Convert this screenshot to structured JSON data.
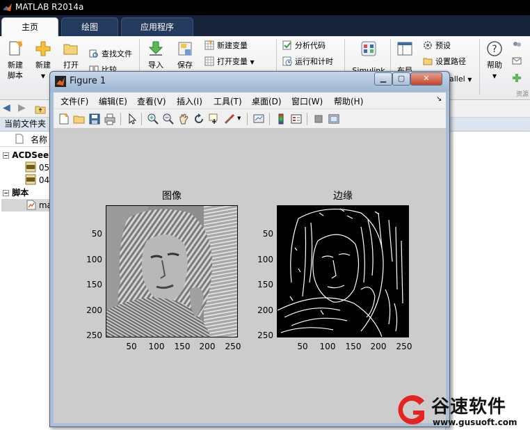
{
  "app": {
    "title": "MATLAB R2014a"
  },
  "ribbon_tabs": [
    {
      "label": "主页",
      "active": true
    },
    {
      "label": "绘图",
      "active": false
    },
    {
      "label": "应用程序",
      "active": false
    }
  ],
  "ribbon": {
    "new_script": [
      "新建",
      "脚本"
    ],
    "new": "新建",
    "open": "打开",
    "find_files": "查找文件",
    "compare": "比较",
    "import": "导入",
    "save": "保存",
    "new_variable": "新建变量",
    "open_variable": "打开变量",
    "analyze_code": "分析代码",
    "run_and_time": "运行和计时",
    "simulink": "Simulink",
    "layout": "布局",
    "preferences": "预设",
    "set_path": "设置路径",
    "parallel": "allel",
    "help": "帮助",
    "resources": "资源"
  },
  "current_folder": {
    "header": "当前文件夹",
    "name_col": "名称"
  },
  "tree": [
    {
      "label": "ACDSee",
      "kind": "group"
    },
    {
      "label": "05",
      "kind": "file"
    },
    {
      "label": "04",
      "kind": "file"
    },
    {
      "label": "脚本",
      "kind": "group"
    },
    {
      "label": "ma",
      "kind": "file-selected"
    }
  ],
  "figure": {
    "title": "Figure 1",
    "menu": [
      "文件(F)",
      "编辑(E)",
      "查看(V)",
      "插入(I)",
      "工具(T)",
      "桌面(D)",
      "窗口(W)",
      "帮助(H)"
    ],
    "toolbar_icons": [
      "new-figure-icon",
      "open-file-icon",
      "save-icon",
      "print-icon",
      "pointer-icon",
      "zoom-in-icon",
      "zoom-out-icon",
      "pan-icon",
      "rotate-icon",
      "data-cursor-icon",
      "brush-icon",
      "link-plot-icon",
      "colorbar-icon",
      "legend-icon",
      "hide-plot-tools-icon",
      "show-plot-tools-icon"
    ],
    "subplots": [
      {
        "title": "图像",
        "kind": "grayscale-photo"
      },
      {
        "title": "边缘",
        "kind": "edge-map"
      }
    ],
    "yticks": [
      "50",
      "100",
      "150",
      "200",
      "250"
    ],
    "xticks": [
      "50",
      "100",
      "150",
      "200",
      "250"
    ],
    "axis_range": [
      1,
      256
    ]
  },
  "watermark": {
    "brand": "谷速软件",
    "url": "www.gusuoft.com"
  },
  "colors": {
    "titlebar": "#000000",
    "tabbar": "#17233a",
    "figure_bg": "#cccccc",
    "close_button": "#c2452c"
  }
}
